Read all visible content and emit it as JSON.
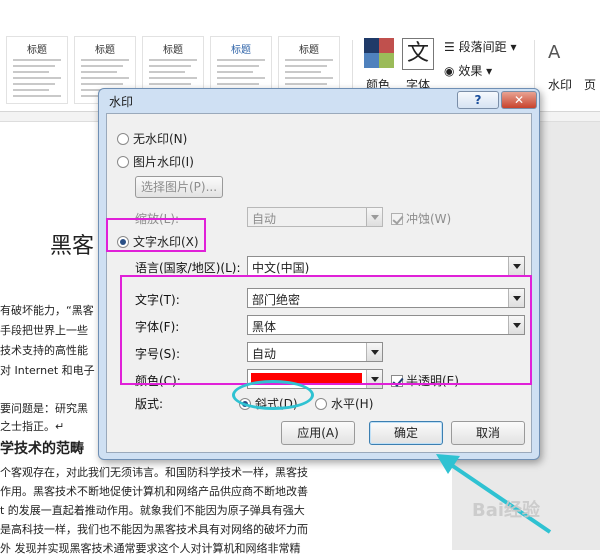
{
  "ribbon": {
    "style_thumbs": [
      {
        "title": "标题",
        "blue": false
      },
      {
        "title": "标题",
        "blue": false
      },
      {
        "title": "标题",
        "blue": false
      },
      {
        "title": "标题",
        "blue": true
      },
      {
        "title": "标题",
        "blue": false
      }
    ],
    "colors_label": "颜色",
    "fonts_label": "字体",
    "fonts_glyph": "文",
    "paragraph_spacing_label": "段落间距",
    "effects_label": "效果",
    "watermark_label": "水印",
    "page_label": "页"
  },
  "document": {
    "title_fragment": "黑客",
    "lines": [
      "有破坏能力，“黑客",
      "手段把世界上一些",
      "技术支持的高性能",
      "对 Internet 和电子",
      "",
      "要问题是：研究黑",
      "之士指正。↵"
    ],
    "heading_fragment": "学技术的范畴",
    "right_lines": [
      "",
      "个客观存在，对此我们无须讳言。和国防科学技术一样，黑客技",
      "作用。黑客技术不断地促使计算机和网络产品供应商不断地改善",
      "t 的发展一直起着推动作用。就象我们不能因为原子弹具有强大",
      "是高科技一样，我们也不能因为黑客技术具有对网络的破坏力而",
      "外  发现并实现黑客技术通常要求这个人对计算机和网络非常精"
    ]
  },
  "dialog": {
    "title": "水印",
    "help_glyph": "?",
    "close_glyph": "✕",
    "no_watermark_label": "无水印(N)",
    "picture_watermark_label": "图片水印(I)",
    "select_picture_label": "选择图片(P)...",
    "scale_label": "缩放(L):",
    "scale_value": "自动",
    "washout_label": "冲蚀(W)",
    "text_watermark_label": "文字水印(X)",
    "language_label": "语言(国家/地区)(L):",
    "language_value": "中文(中国)",
    "text_label": "文字(T):",
    "text_value": "部门绝密",
    "font_label": "字体(F):",
    "font_value": "黑体",
    "size_label": "字号(S):",
    "size_value": "自动",
    "color_label": "颜色(C):",
    "color_value": "#ff0000",
    "semitransparent_label": "半透明(E)",
    "layout_label": "版式:",
    "diagonal_label": "斜式(D)",
    "horizontal_label": "水平(H)",
    "apply_label": "应用(A)",
    "ok_label": "确定",
    "cancel_label": "取消"
  },
  "watermark_site": "Bai经验"
}
